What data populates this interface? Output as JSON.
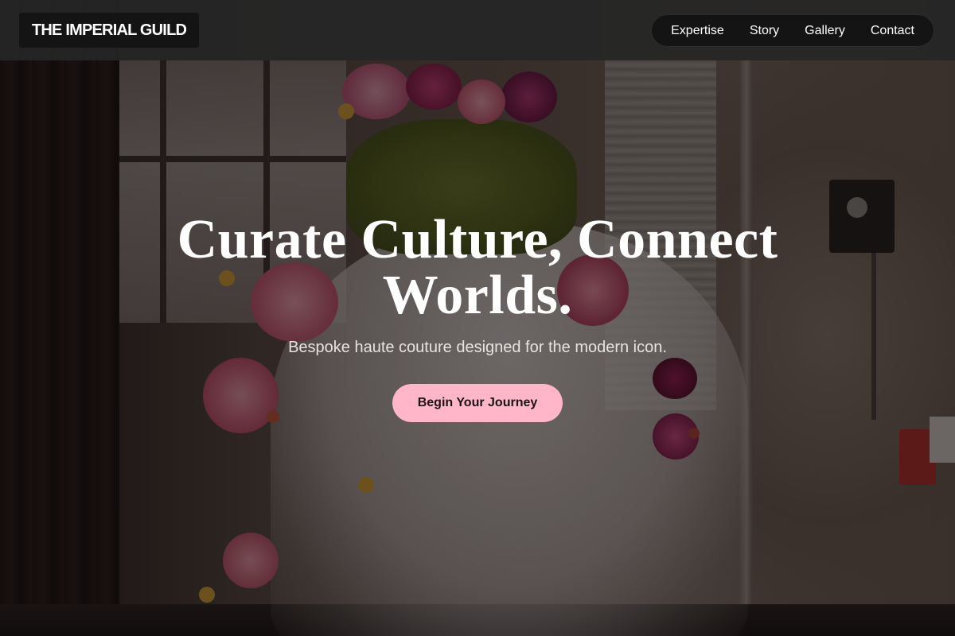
{
  "brand": {
    "logo_text": "THE IMPERIAL GUILD"
  },
  "nav": {
    "items": [
      {
        "label": "Expertise"
      },
      {
        "label": "Story"
      },
      {
        "label": "Gallery"
      },
      {
        "label": "Contact"
      }
    ]
  },
  "hero": {
    "title": "Curate Culture, Connect Worlds.",
    "subtitle": "Bespoke haute couture designed for the modern icon.",
    "cta_label": "Begin Your Journey"
  },
  "colors": {
    "accent": "#ffb6c9",
    "header_bg": "#262626",
    "text": "#ffffff"
  }
}
